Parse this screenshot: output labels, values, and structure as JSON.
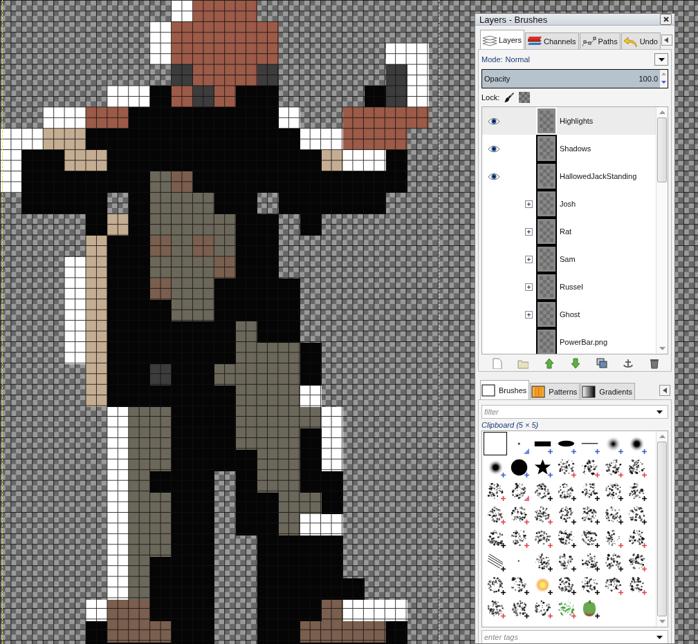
{
  "window": {
    "title": "Layers - Brushes"
  },
  "layers_panel": {
    "tabs": [
      {
        "label": "Layers",
        "selected": true
      },
      {
        "label": "Channels",
        "selected": false
      },
      {
        "label": "Paths",
        "selected": false
      },
      {
        "label": "Undo",
        "selected": false
      }
    ],
    "mode": {
      "label": "Mode:",
      "value": "Normal"
    },
    "opacity": {
      "label": "Opacity",
      "reading": "100.0",
      "level": 1
    },
    "lock": {
      "label": "Lock:"
    },
    "layers": [
      {
        "name": "Highlights",
        "kind": "layer",
        "visible": true,
        "selected": true
      },
      {
        "name": "Shadows",
        "kind": "layer",
        "visible": true,
        "selected": false
      },
      {
        "name": "HallowedJackStanding",
        "kind": "layer",
        "visible": true,
        "selected": false
      },
      {
        "name": "Josh",
        "kind": "group",
        "visible": false,
        "selected": false
      },
      {
        "name": "Rat",
        "kind": "group",
        "visible": false,
        "selected": false
      },
      {
        "name": "Sam",
        "kind": "group",
        "visible": false,
        "selected": false
      },
      {
        "name": "Russel",
        "kind": "group",
        "visible": false,
        "selected": false
      },
      {
        "name": "Ghost",
        "kind": "group",
        "visible": false,
        "selected": false
      },
      {
        "name": "PowerBar.png",
        "kind": "layer",
        "visible": false,
        "selected": false
      }
    ]
  },
  "brushes_panel": {
    "tabs": [
      {
        "label": "Brushes",
        "selected": true
      },
      {
        "label": "Patterns",
        "selected": false
      },
      {
        "label": "Gradients",
        "selected": false
      }
    ],
    "filter": {
      "placeholder": "filter"
    },
    "heading": "Clipboard (5 × 5)",
    "brushes": [
      {
        "selected": true,
        "kind": "none"
      },
      {
        "selected": false,
        "kind": "corner",
        "color": "#6a86e8"
      },
      {
        "selected": false,
        "kind": "plus",
        "color": "#3a5cd0"
      },
      {
        "selected": false,
        "kind": "plus",
        "color": "#3a5cd0"
      },
      {
        "selected": false,
        "kind": "plus",
        "color": "#3a5cd0"
      },
      {
        "selected": false,
        "kind": "plus",
        "color": "#3a5cd0"
      },
      {
        "selected": false,
        "kind": "plus",
        "color": "#3a5cd0"
      },
      {
        "selected": false,
        "kind": "plus",
        "color": "#3a5cd0"
      },
      {
        "selected": false,
        "kind": "plus",
        "color": "#3a5cd0"
      },
      {
        "selected": false,
        "kind": "plus",
        "color": "#3a5cd0"
      },
      {
        "selected": false,
        "kind": "plus",
        "color": "#e0404a"
      },
      {
        "selected": false,
        "kind": "plus",
        "color": "#e0404a"
      },
      {
        "selected": false,
        "kind": "plus",
        "color": "#e0404a"
      },
      {
        "selected": false,
        "kind": "plus",
        "color": "#e0404a"
      },
      {
        "selected": false,
        "kind": "plus",
        "color": "#e0404a"
      },
      {
        "selected": false,
        "kind": "corner",
        "color": "#e87080"
      },
      {
        "selected": false,
        "kind": "plus",
        "color": "#000000"
      },
      {
        "selected": false,
        "kind": "plus",
        "color": "#000000"
      },
      {
        "selected": false,
        "kind": "plus",
        "color": "#000000"
      },
      {
        "selected": false,
        "kind": "plus",
        "color": "#000000"
      },
      {
        "selected": false,
        "kind": "plus",
        "color": "#000000"
      },
      {
        "selected": false,
        "kind": "plus",
        "color": "#e0404a"
      },
      {
        "selected": false,
        "kind": "plus",
        "color": "#e0404a"
      },
      {
        "selected": false,
        "kind": "plus",
        "color": "#e0404a"
      },
      {
        "selected": false,
        "kind": "plus",
        "color": "#000000"
      },
      {
        "selected": false,
        "kind": "plus",
        "color": "#000000"
      },
      {
        "selected": false,
        "kind": "plus",
        "color": "#000000"
      },
      {
        "selected": false,
        "kind": "plus",
        "color": "#000000"
      },
      {
        "selected": false,
        "kind": "plus",
        "color": "#000000"
      },
      {
        "selected": false,
        "kind": "plus",
        "color": "#e0404a"
      },
      {
        "selected": false,
        "kind": "plus",
        "color": "#e0404a"
      },
      {
        "selected": false,
        "kind": "plus",
        "color": "#000000"
      },
      {
        "selected": false,
        "kind": "plus",
        "color": "#000000"
      },
      {
        "selected": false,
        "kind": "plus",
        "color": "#e0404a"
      },
      {
        "selected": false,
        "kind": "plus",
        "color": "#e0404a"
      },
      {
        "selected": false,
        "kind": "plus",
        "color": "#000000"
      },
      {
        "selected": false,
        "kind": "none"
      },
      {
        "selected": false,
        "kind": "plus",
        "color": "#000000"
      },
      {
        "selected": false,
        "kind": "plus",
        "color": "#000000"
      },
      {
        "selected": false,
        "kind": "plus",
        "color": "#000000"
      },
      {
        "selected": false,
        "kind": "plus",
        "color": "#000000"
      },
      {
        "selected": false,
        "kind": "plus",
        "color": "#e0404a"
      },
      {
        "selected": false,
        "kind": "plus",
        "color": "#000000"
      },
      {
        "selected": false,
        "kind": "plus",
        "color": "#000000"
      },
      {
        "selected": false,
        "kind": "plus",
        "color": "#000000"
      },
      {
        "selected": false,
        "kind": "plus",
        "color": "#000000"
      },
      {
        "selected": false,
        "kind": "plus",
        "color": "#000000"
      },
      {
        "selected": false,
        "kind": "plus",
        "color": "#e0404a"
      },
      {
        "selected": false,
        "kind": "plus",
        "color": "#e0404a"
      },
      {
        "selected": false,
        "kind": "plus",
        "color": "#e0404a"
      },
      {
        "selected": false,
        "kind": "plus",
        "color": "#000000"
      },
      {
        "selected": false,
        "kind": "plus",
        "color": "#e0404a"
      },
      {
        "selected": false,
        "kind": "plus",
        "color": "#e0404a"
      },
      {
        "selected": false,
        "kind": "plus",
        "color": "#000000"
      }
    ],
    "tags": {
      "placeholder": "enter tags"
    }
  }
}
